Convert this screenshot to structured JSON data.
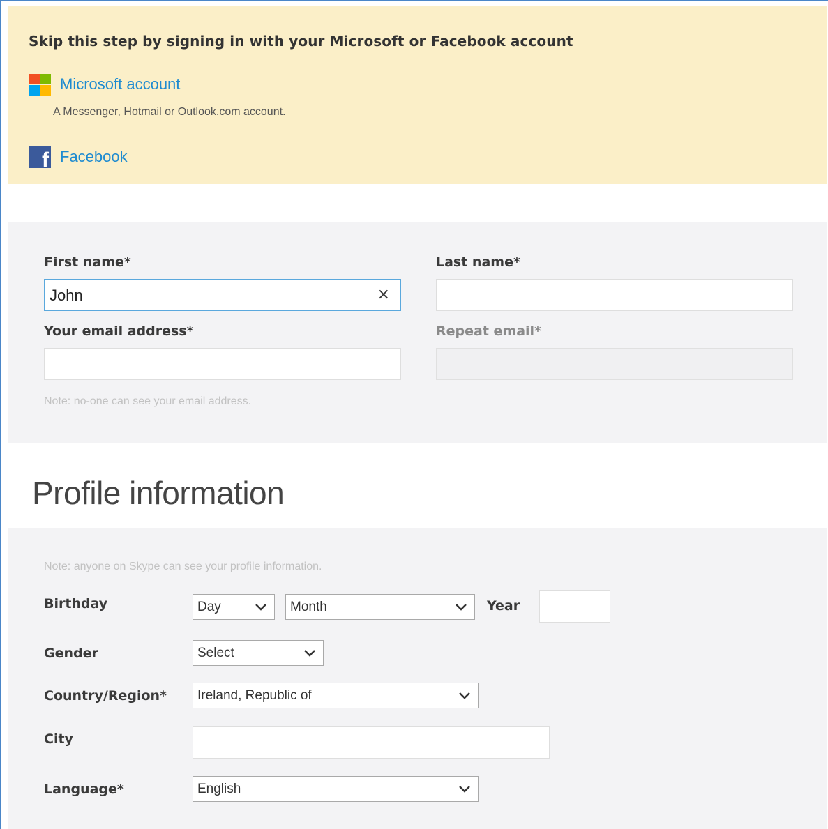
{
  "signin": {
    "heading": "Skip this step by signing in with your Microsoft or Facebook account",
    "microsoft_label": "Microsoft account",
    "microsoft_sub": "A Messenger, Hotmail or Outlook.com account.",
    "facebook_label": "Facebook",
    "microsoft_logo_colors": [
      "#f25022",
      "#7fba00",
      "#00a4ef",
      "#ffb900"
    ],
    "facebook_color": "#3b5a9b",
    "facebook_glyph": "f"
  },
  "account": {
    "first_name_label": "First name*",
    "first_name_value": "John",
    "clear_glyph": "×",
    "last_name_label": "Last name*",
    "last_name_value": "",
    "email_label": "Your email address*",
    "email_value": "",
    "repeat_email_label": "Repeat email*",
    "repeat_email_value": "",
    "email_note": "Note: no-one can see your email address."
  },
  "profile": {
    "title": "Profile information",
    "note": "Note: anyone on Skype can see your profile information.",
    "birthday_label": "Birthday",
    "day_value": "Day",
    "month_value": "Month",
    "year_label": "Year",
    "year_value": "",
    "gender_label": "Gender",
    "gender_value": "Select",
    "country_label": "Country/Region*",
    "country_value": "Ireland, Republic of",
    "city_label": "City",
    "city_value": "",
    "language_label": "Language*",
    "language_value": "English"
  },
  "colors": {
    "banner_bg": "#fbefc8",
    "section_bg": "#f3f3f5",
    "link": "#1f8bd0",
    "focus_border": "#5aa8dd"
  }
}
